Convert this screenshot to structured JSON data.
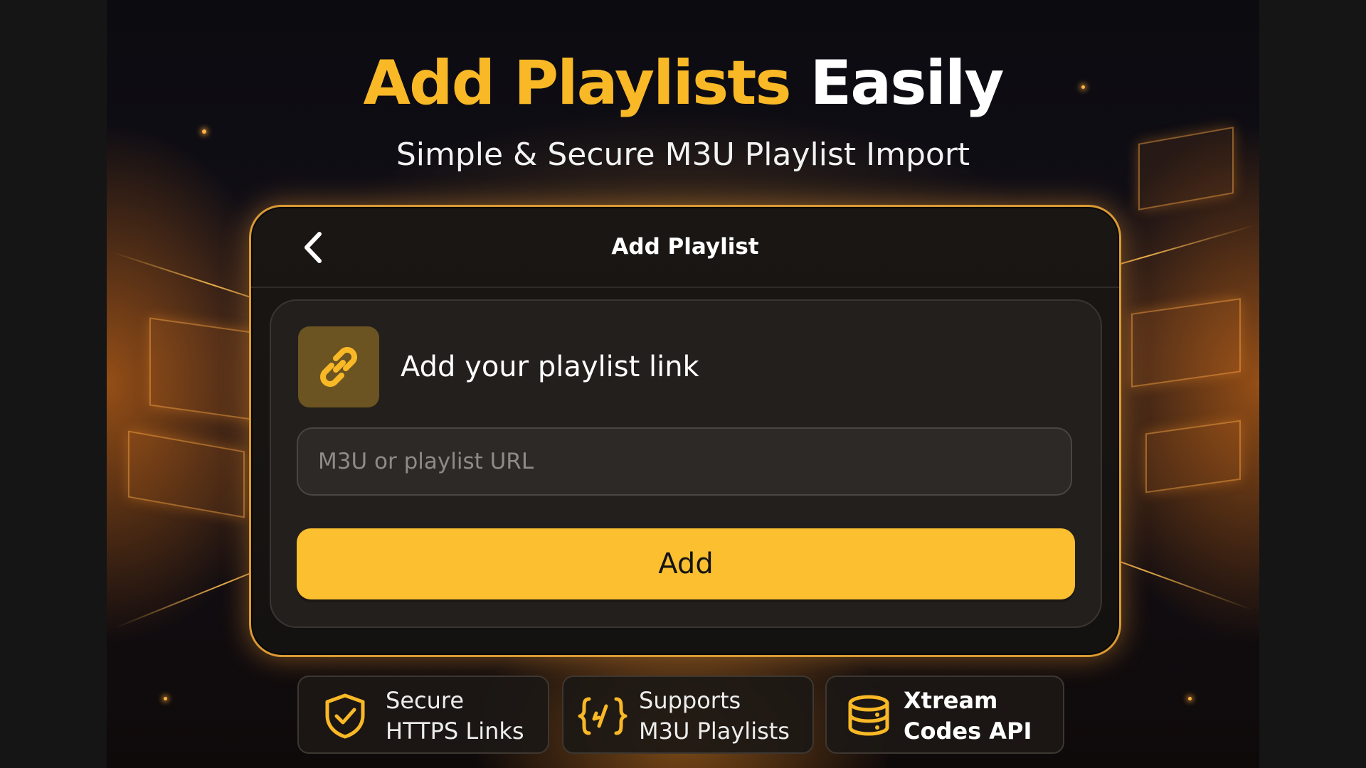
{
  "hero": {
    "title_accent": "Add Playlists",
    "title_rest": "Easily",
    "subtitle": "Simple & Secure M3U Playlist Import"
  },
  "dialog": {
    "back_icon": "chevron-left-icon",
    "title": "Add Playlist",
    "card": {
      "icon": "link-icon",
      "heading": "Add your playlist link",
      "url_input": {
        "placeholder": "M3U or playlist URL",
        "value": ""
      },
      "add_button_label": "Add"
    }
  },
  "features": [
    {
      "icon": "shield-check-icon",
      "line1": "Secure",
      "line2": "HTTPS Links"
    },
    {
      "icon": "code-braces-icon",
      "line1": "Supports",
      "line2": "M3U Playlists"
    },
    {
      "icon": "server-stack-icon",
      "line1": "Xtream",
      "line2": "Codes API"
    }
  ],
  "colors": {
    "accent": "#f9b826",
    "button": "#fbbf2f",
    "panel_border": "#d99a34",
    "background": "#0b0b10"
  }
}
